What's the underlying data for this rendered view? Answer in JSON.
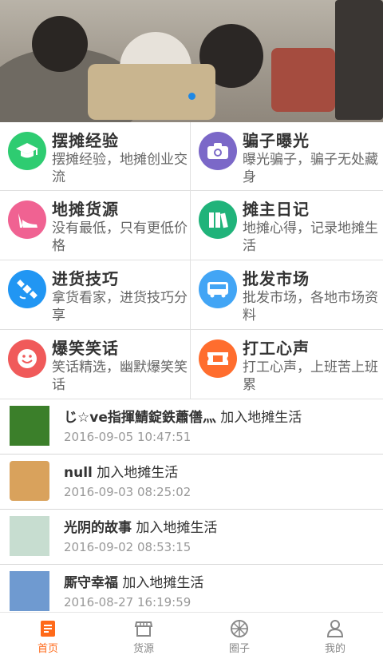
{
  "banner": {
    "slide_count": 1,
    "active_slide": 1
  },
  "categories": [
    {
      "title": "摆摊经验",
      "desc": "摆摊经验，地摊创业交流",
      "color": "#2ecc71",
      "icon": "graduation-cap-icon"
    },
    {
      "title": "骗子曝光",
      "desc": "曝光骗子，骗子无处藏身",
      "color": "#7b68c8",
      "icon": "camera-icon"
    },
    {
      "title": "地摊货源",
      "desc": "没有最低，只有更低价格",
      "color": "#f06292",
      "icon": "high-heel-icon"
    },
    {
      "title": "摊主日记",
      "desc": "地摊心得，记录地摊生活",
      "color": "#20b37a",
      "icon": "books-icon"
    },
    {
      "title": "进货技巧",
      "desc": "拿货看家，进货技巧分享",
      "color": "#2196f3",
      "icon": "satellite-icon"
    },
    {
      "title": "批发市场",
      "desc": "批发市场，各地市场资料",
      "color": "#42a5f5",
      "icon": "bus-icon"
    },
    {
      "title": "爆笑笑话",
      "desc": "笑话精选，幽默爆笑笑话",
      "color": "#f05a5a",
      "icon": "smile-icon"
    },
    {
      "title": "打工心声",
      "desc": "打工心声，上班苦上班累",
      "color": "#ff6d2e",
      "icon": "ticket-icon"
    }
  ],
  "feed": [
    {
      "name": "じ☆ve指揮鯖錠鉄蕭僐灬",
      "action": "加入地摊生活",
      "time": "2016-09-05 10:47:51"
    },
    {
      "name": "null",
      "action": "加入地摊生活",
      "time": "2016-09-03 08:25:02"
    },
    {
      "name": "光阴的故事",
      "action": "加入地摊生活",
      "time": "2016-09-02 08:53:15"
    },
    {
      "name": "厮守幸福",
      "action": "加入地摊生活",
      "time": "2016-08-27 16:19:59"
    }
  ],
  "tabbar": [
    {
      "label": "首页",
      "icon": "home-icon",
      "active": true
    },
    {
      "label": "货源",
      "icon": "store-icon",
      "active": false
    },
    {
      "label": "圈子",
      "icon": "circle-icon",
      "active": false
    },
    {
      "label": "我的",
      "icon": "user-icon",
      "active": false
    }
  ],
  "colors": {
    "accent": "#ff6a1a",
    "indicator": "#1e88e5"
  }
}
